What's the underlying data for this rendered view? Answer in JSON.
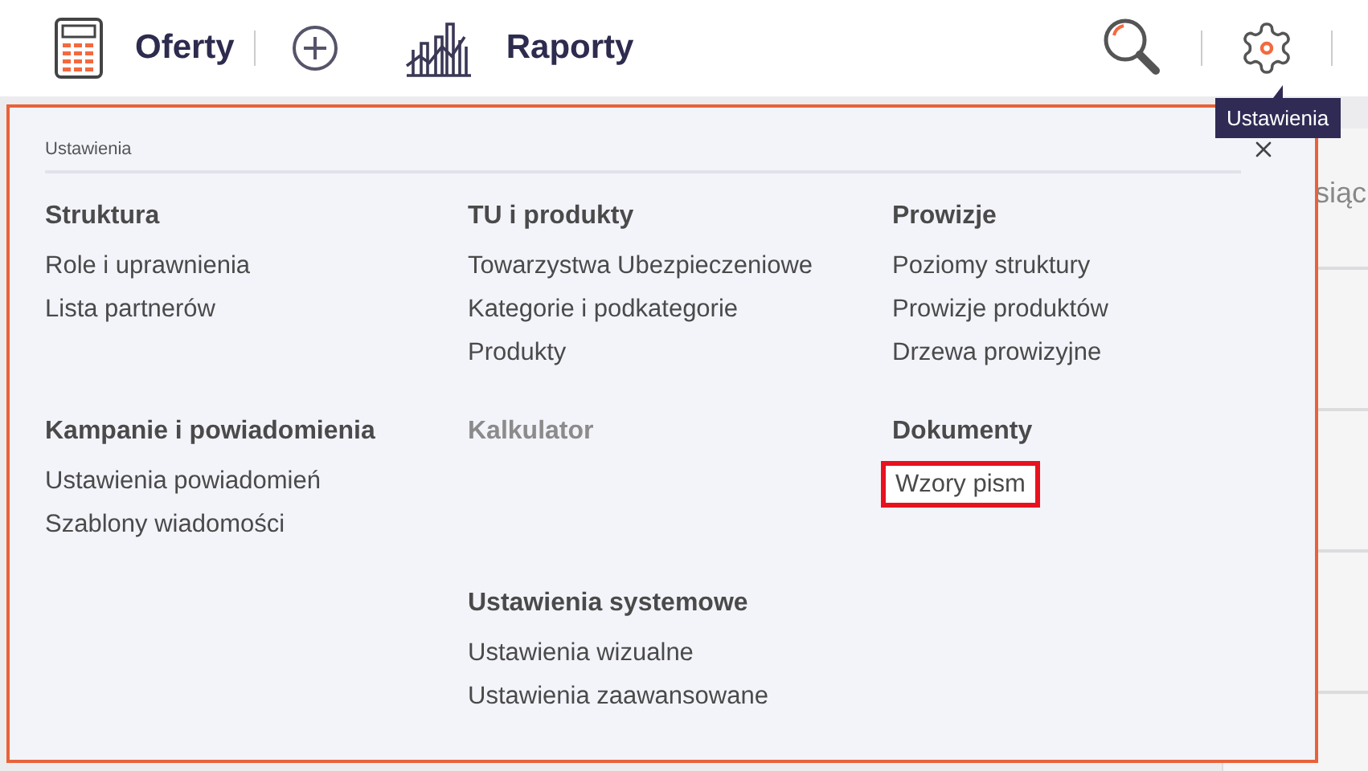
{
  "nav": [
    {
      "kind": "calculator",
      "label": "Oferty"
    },
    {
      "kind": "add"
    },
    {
      "kind": "chart",
      "label": "Raporty"
    }
  ],
  "background": {
    "column_text": "siąc"
  },
  "tooltip": {
    "text": "Ustawienia"
  },
  "menu": {
    "title": "Ustawienia",
    "columns": [
      {
        "sections": [
          {
            "heading": "Struktura",
            "disabled": false,
            "items": [
              {
                "label": "Role i uprawnienia",
                "highlighted": false
              },
              {
                "label": "Lista partnerów",
                "highlighted": false
              }
            ]
          },
          {
            "heading": "Kampanie i powiadomienia",
            "disabled": false,
            "items": [
              {
                "label": "Ustawienia powiadomień",
                "highlighted": false
              },
              {
                "label": "Szablony wiadomości",
                "highlighted": false
              }
            ]
          }
        ]
      },
      {
        "sections": [
          {
            "heading": "TU i produkty",
            "disabled": false,
            "items": [
              {
                "label": "Towarzystwa Ubezpieczeniowe",
                "highlighted": false
              },
              {
                "label": "Kategorie i podkategorie",
                "highlighted": false
              },
              {
                "label": "Produkty",
                "highlighted": false
              }
            ]
          },
          {
            "heading": "Kalkulator",
            "disabled": true
          },
          {
            "heading": "Ustawienia systemowe",
            "disabled": false,
            "items": [
              {
                "label": "Ustawienia wizualne",
                "highlighted": false
              },
              {
                "label": "Ustawienia zaawansowane",
                "highlighted": false
              }
            ]
          }
        ]
      },
      {
        "sections": [
          {
            "heading": "Prowizje",
            "disabled": false,
            "items": [
              {
                "label": "Poziomy struktury",
                "highlighted": false
              },
              {
                "label": "Prowizje produktów",
                "highlighted": false
              },
              {
                "label": "Drzewa prowizyjne",
                "highlighted": false
              }
            ]
          },
          {
            "heading": "Dokumenty",
            "disabled": false,
            "items": [
              {
                "label": "Wzory pism",
                "highlighted": true
              }
            ]
          }
        ]
      }
    ]
  }
}
